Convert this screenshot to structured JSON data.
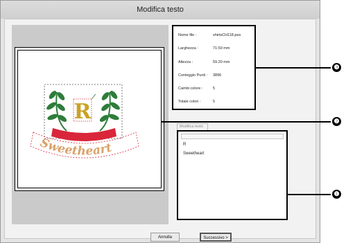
{
  "window": {
    "title": "Modifica testo"
  },
  "info": {
    "rows": [
      {
        "label": "Nome file :",
        "value": "shirtsCH118.pes"
      },
      {
        "label": "Larghezza :",
        "value": "71.50   mm"
      },
      {
        "label": "Altezza :",
        "value": "59.20   mm"
      },
      {
        "label": "Conteggio Punti :",
        "value": "3896"
      },
      {
        "label": "Cambi colore :",
        "value": "5"
      },
      {
        "label": "Totale colori :",
        "value": "5"
      }
    ]
  },
  "edit": {
    "tab_label": "Modifica testo",
    "items": [
      "R",
      "Sweetheart"
    ]
  },
  "design": {
    "monogram": "R",
    "banner_text": "Sweetheart"
  },
  "buttons": {
    "cancel": "Annulla",
    "next": "Successivo >"
  },
  "callouts": [
    "❸",
    "❷",
    "❶"
  ],
  "colors": {
    "leaf_green": "#2e7d3a",
    "gold": "#c9a227",
    "ribbon_red": "#d9263a",
    "banner_tan": "#d8a26a"
  }
}
